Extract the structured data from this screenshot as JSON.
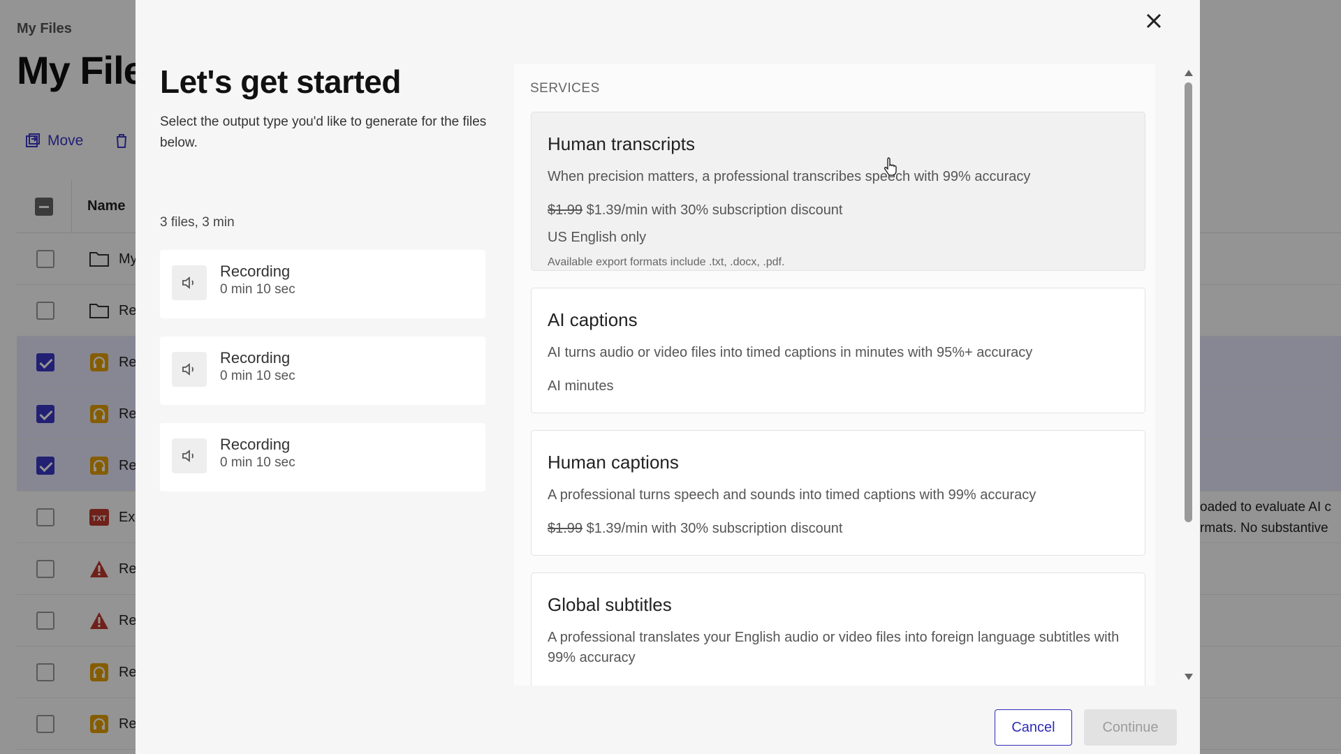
{
  "background": {
    "breadcrumb": "My Files",
    "title": "My Files",
    "toolbar": {
      "move_label": "Move"
    },
    "table": {
      "name_header": "Name",
      "rows": [
        {
          "name": "My",
          "icon": "folder-icon",
          "selected": false
        },
        {
          "name": "Re",
          "icon": "folder-icon",
          "selected": false
        },
        {
          "name": "Re",
          "icon": "audio-file-icon",
          "selected": true
        },
        {
          "name": "Re",
          "icon": "audio-file-icon",
          "selected": true
        },
        {
          "name": "Re",
          "icon": "audio-file-icon",
          "selected": true
        },
        {
          "name": "Ex",
          "icon": "txt-file-icon",
          "selected": false
        },
        {
          "name": "Re",
          "icon": "warning-icon",
          "selected": false
        },
        {
          "name": "Re",
          "icon": "warning-icon",
          "selected": false
        },
        {
          "name": "Re",
          "icon": "audio-file-icon",
          "selected": false
        },
        {
          "name": "Re",
          "icon": "audio-file-icon",
          "selected": false
        }
      ]
    },
    "side_text": {
      "line1": "oaded to evaluate AI c",
      "line2": "rmats. No substantive"
    }
  },
  "modal": {
    "title": "Let's get started",
    "subtitle": "Select the output type you'd like to generate for the files below.",
    "files_count": "3 files, 3 min",
    "files": [
      {
        "name": "Recording",
        "duration": "0 min 10 sec"
      },
      {
        "name": "Recording",
        "duration": "0 min 10 sec"
      },
      {
        "name": "Recording",
        "duration": "0 min 10 sec"
      }
    ],
    "services_label": "SERVICES",
    "services": [
      {
        "title": "Human transcripts",
        "description": "When precision matters, a professional transcribes speech with 99% accuracy",
        "old_price": "$1.99",
        "price": "$1.39/min with 30% subscription discount",
        "note": "US English only",
        "formats": "Available export formats include .txt, .docx, .pdf."
      },
      {
        "title": "AI captions",
        "description": "AI turns audio or video files into timed captions in minutes with 95%+ accuracy",
        "price": "AI minutes"
      },
      {
        "title": "Human captions",
        "description": "A professional turns speech and sounds into timed captions with 99% accuracy",
        "old_price": "$1.99",
        "price": "$1.39/min with 30% subscription discount"
      },
      {
        "title": "Global subtitles",
        "description": "A professional translates your English audio or video files into foreign language subtitles with 99% accuracy"
      }
    ],
    "buttons": {
      "cancel": "Cancel",
      "continue": "Continue"
    }
  },
  "colors": {
    "accent": "#2f2bb8",
    "selected_row": "#e8e8ff",
    "txt_badge": "#c0392b",
    "warning": "#c0392b",
    "audio_badge": "#e6a100"
  }
}
